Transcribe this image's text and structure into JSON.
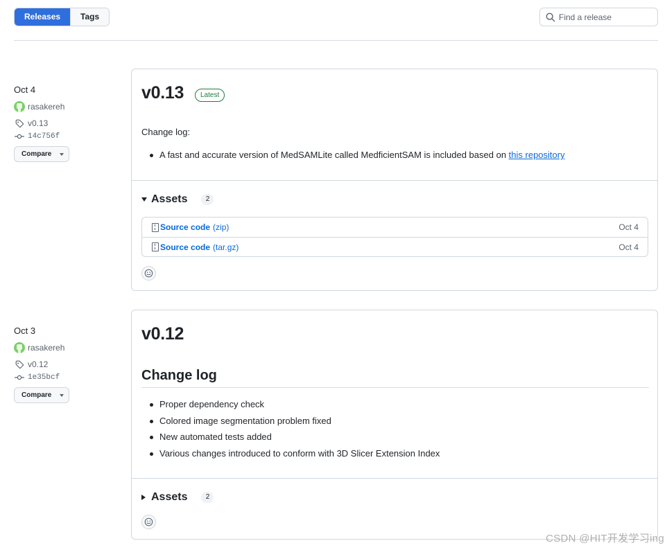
{
  "nav": {
    "releases_label": "Releases",
    "tags_label": "Tags",
    "search_placeholder": "Find a release"
  },
  "colors": {
    "accent": "#2f6fdd",
    "link": "#0969da",
    "latest": "#1a7f37"
  },
  "releases": [
    {
      "date": "Oct 4",
      "author": "rasakereh",
      "tag": "v0.13",
      "commit": "14c756f",
      "compare_label": "Compare",
      "version": "v0.13",
      "latest_label": "Latest",
      "changelog_label": "Change log:",
      "items": [
        {
          "text": "A fast and accurate version of MedSAMLite called MedficientSAM is included based on ",
          "link": "this repository"
        }
      ],
      "assets_label": "Assets",
      "assets_count": "2",
      "assets": [
        {
          "name": "Source code",
          "ext": "(zip)",
          "date": "Oct 4"
        },
        {
          "name": "Source code",
          "ext": "(tar.gz)",
          "date": "Oct 4"
        }
      ]
    },
    {
      "date": "Oct 3",
      "author": "rasakereh",
      "tag": "v0.12",
      "commit": "1e35bcf",
      "compare_label": "Compare",
      "version": "v0.12",
      "changelog_heading": "Change log",
      "items": [
        "Proper dependency check",
        "Colored image segmentation problem fixed",
        "New automated tests added",
        "Various changes introduced to conform with 3D Slicer Extension Index"
      ],
      "assets_label": "Assets",
      "assets_count": "2"
    }
  ],
  "watermark": "CSDN @HIT开发学习ing"
}
